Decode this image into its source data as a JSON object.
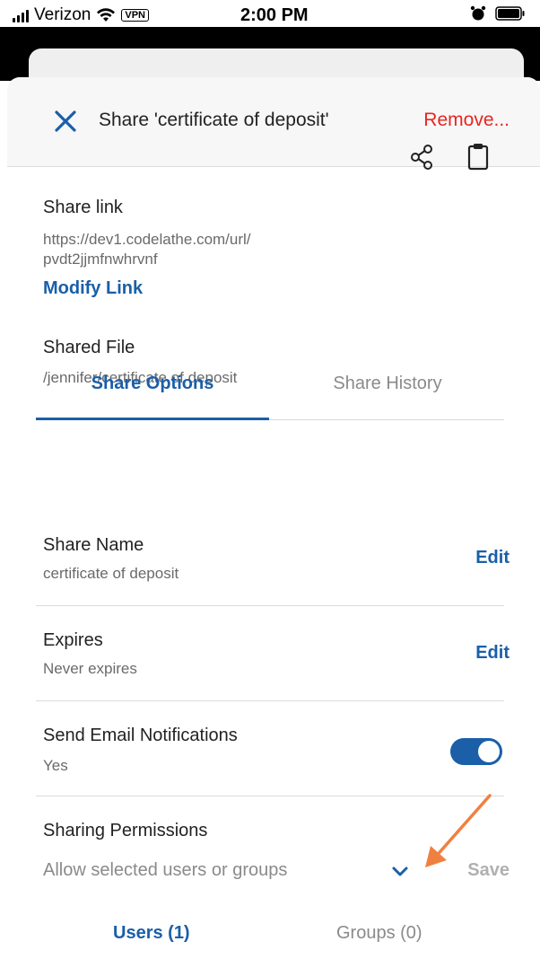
{
  "status_bar": {
    "carrier": "Verizon",
    "vpn": "VPN",
    "time": "2:00 PM"
  },
  "header": {
    "title": "Share 'certificate of deposit'",
    "remove_label": "Remove..."
  },
  "share_link": {
    "label": "Share link",
    "url_line1": "https://dev1.codelathe.com/url/",
    "url_line2": "pvdt2jjmfnwhrvnf",
    "modify_label": "Modify Link"
  },
  "shared_file": {
    "label": "Shared File",
    "path": "/jennifer/certificate of deposit"
  },
  "tabs": [
    {
      "label": "Share Options",
      "active": true
    },
    {
      "label": "Share History",
      "active": false
    }
  ],
  "options": {
    "share_name": {
      "label": "Share Name",
      "value": "certificate of deposit",
      "action": "Edit"
    },
    "expires": {
      "label": "Expires",
      "value": "Never expires",
      "action": "Edit"
    },
    "notifications": {
      "label": "Send Email Notifications",
      "value": "Yes",
      "enabled": true
    }
  },
  "permissions": {
    "label": "Sharing Permissions",
    "selected": "Allow selected users or groups",
    "save_label": "Save"
  },
  "bottom_tabs": {
    "users": "Users (1)",
    "groups": "Groups (0)"
  },
  "colors": {
    "accent": "#1a5fa8",
    "danger": "#e8261f",
    "annotation": "#f08040"
  },
  "icons": [
    "wifi-icon",
    "alarm-icon",
    "battery-icon",
    "close-icon",
    "share-icon",
    "clipboard-icon",
    "chevron-down-icon",
    "arrow-annotation"
  ]
}
